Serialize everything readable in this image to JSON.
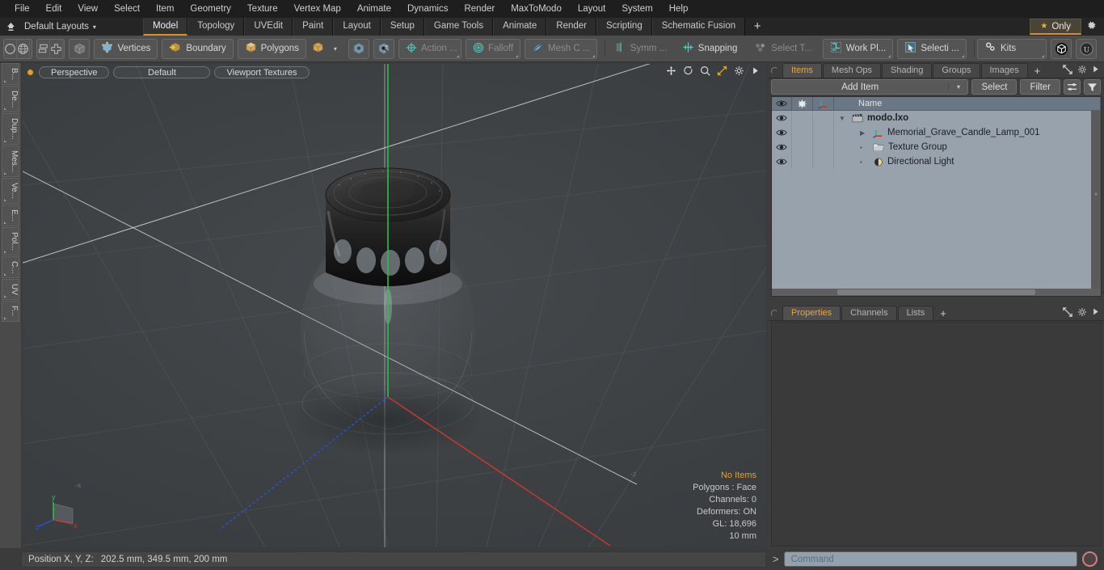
{
  "menubar": {
    "items": [
      "File",
      "Edit",
      "View",
      "Select",
      "Item",
      "Geometry",
      "Texture",
      "Vertex Map",
      "Animate",
      "Dynamics",
      "Render",
      "MaxToModo",
      "Layout",
      "System",
      "Help"
    ]
  },
  "layoutbar": {
    "home_icon": "home-icon",
    "title": "Default Layouts",
    "caret": "▾",
    "tabs": [
      {
        "label": "Model",
        "active": true
      },
      {
        "label": "Topology",
        "active": false
      },
      {
        "label": "UVEdit",
        "active": false
      },
      {
        "label": "Paint",
        "active": false
      },
      {
        "label": "Layout",
        "active": false
      },
      {
        "label": "Setup",
        "active": false
      },
      {
        "label": "Game Tools",
        "active": false
      },
      {
        "label": "Animate",
        "active": false
      },
      {
        "label": "Render",
        "active": false
      },
      {
        "label": "Scripting",
        "active": false
      },
      {
        "label": "Schematic Fusion",
        "active": false
      }
    ],
    "plus": "+",
    "only_label": "Only",
    "only_star": "★",
    "gear_icon": "gear-icon",
    "accent": "#d39327"
  },
  "toolbar": {
    "shape_tools": [
      "circle-icon",
      "globe-icon",
      "pen-icon",
      "polygon-pen-icon"
    ],
    "arrange_tools": [
      "align-icon",
      "center-icon",
      "boolean-icon",
      "radial-icon"
    ],
    "cube_icon": "cube-icon",
    "selection_modes": [
      {
        "label": "Vertices",
        "icon": "vertices-icon"
      },
      {
        "label": "Boundary",
        "icon": "boundary-icon"
      },
      {
        "label": "Polygons",
        "icon": "polygons-icon"
      }
    ],
    "cube_dropdown_caret": "▾",
    "pivot_icons": [
      "action-center-icon",
      "falloff-center-icon"
    ],
    "modifiers": [
      {
        "label": "Action  ...",
        "icon": "action-icon"
      },
      {
        "label": "Falloff",
        "icon": "falloff-icon"
      },
      {
        "label": "Mesh C ...",
        "icon": "mesh-constraint-icon"
      }
    ],
    "symmetry_label": "Symm ...",
    "symmetry_icon": "symmetry-icon",
    "snapping_label": "Snapping",
    "snapping_icon": "snapping-icon",
    "select_through_label": "Select T...",
    "select_through_icon": "select-through-icon",
    "work_plane_label": "Work Pl...",
    "work_plane_icon": "work-plane-icon",
    "selection_set_label": "Selecti ...",
    "selection_set_icon": "selection-icon",
    "kits_label": "Kits",
    "kits_icon": "kits-gears-icon",
    "app_icon": "modo-icon",
    "unreal_icon": "unreal-icon"
  },
  "leftrail": {
    "tabs": [
      "B...",
      "De...",
      "Dup...",
      "Mes...",
      "Ve...",
      "E...",
      "Pol...",
      "C...",
      "UV",
      "F..."
    ]
  },
  "viewport": {
    "dot": "active-dot",
    "pills": [
      "Perspective",
      "Default",
      "Viewport Textures"
    ],
    "tools": [
      "move-icon",
      "rotate-icon",
      "zoom-icon",
      "maximize-icon",
      "gear-icon",
      "arrow-right-icon"
    ],
    "info": {
      "title": "No Items",
      "lines": [
        "Polygons : Face",
        "Channels: 0",
        "Deformers: ON",
        "GL: 18,696",
        "10 mm"
      ]
    },
    "axis_labels": {
      "x": "x",
      "y": "y",
      "z": "z",
      "negx": "-x",
      "negz": "-z"
    },
    "axis_colors": {
      "x": "#c0392b",
      "y": "#27ae60",
      "z": "#2b4fd0"
    }
  },
  "items_panel": {
    "tabs": [
      {
        "label": "Items",
        "active": true
      },
      {
        "label": "Mesh Ops",
        "active": false
      },
      {
        "label": "Shading",
        "active": false
      },
      {
        "label": "Groups",
        "active": false
      },
      {
        "label": "Images",
        "active": false
      }
    ],
    "plus": "+",
    "right_icons": [
      "expand-icon",
      "gear-icon",
      "arrow-right-icon"
    ],
    "add_item_label": "Add Item",
    "add_item_caret": "▾",
    "select_label": "Select",
    "filter_label": "Filter",
    "list_icon": "list-options-icon",
    "funnel_icon": "funnel-icon",
    "columns": [
      "eye-icon",
      "add-icon",
      "axis-icon",
      "Name"
    ],
    "rows": [
      {
        "name": "modo.lxo",
        "icon": "scene-clapper-icon",
        "depth": 0,
        "expander": "▼",
        "bold": true
      },
      {
        "name": "Memorial_Grave_Candle_Lamp_001",
        "icon": "mesh-axis-icon",
        "depth": 1,
        "expander": "▶",
        "bold": false
      },
      {
        "name": "Texture Group",
        "icon": "folder-icon",
        "depth": 1,
        "expander": "",
        "bold": false
      },
      {
        "name": "Directional Light",
        "icon": "light-icon",
        "depth": 1,
        "expander": "",
        "bold": false
      }
    ]
  },
  "properties_panel": {
    "tabs": [
      {
        "label": "Properties",
        "active": true
      },
      {
        "label": "Channels",
        "active": false
      },
      {
        "label": "Lists",
        "active": false
      }
    ],
    "plus": "+",
    "right_icons": [
      "expand-icon",
      "gear-icon",
      "arrow-right-icon"
    ]
  },
  "statusbar": {
    "position_label": "Position X, Y, Z:",
    "position_value": "202.5 mm, 349.5 mm, 200 mm",
    "command_prompt": ">",
    "command_placeholder": "Command",
    "record_icon": "record-icon"
  }
}
